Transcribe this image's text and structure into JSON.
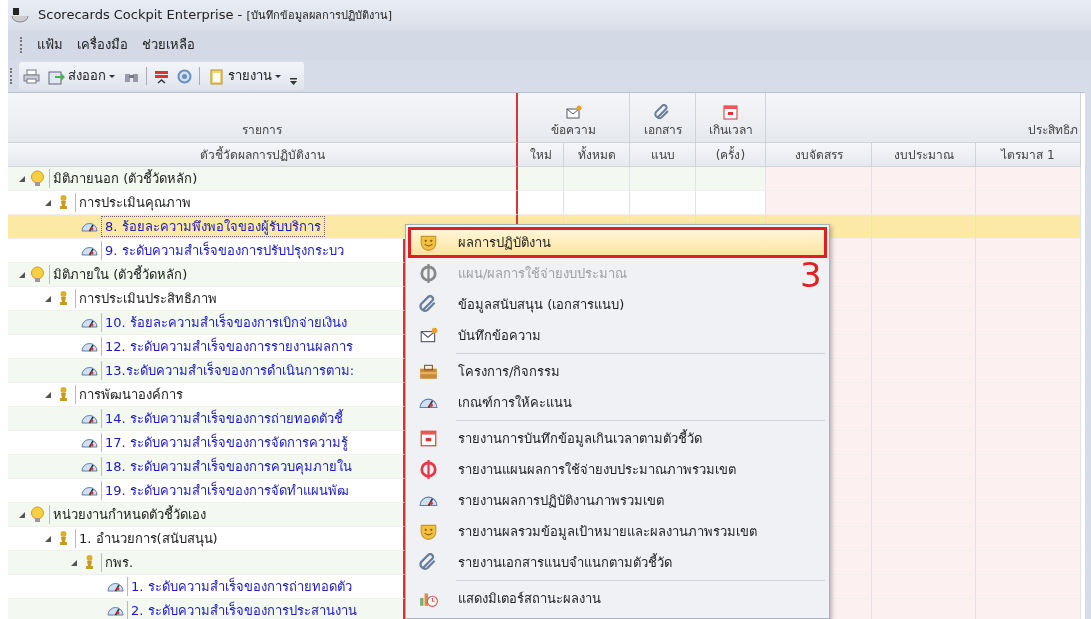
{
  "window": {
    "title": "Scorecards Cockpit Enterprise - ",
    "document": "[บันทึกข้อมูลผลการปฏิบัติงาน]"
  },
  "menu": [
    "แฟ้ม",
    "เครื่องมือ",
    "ช่วยเหลือ"
  ],
  "toolbar": [
    {
      "kind": "print"
    },
    {
      "kind": "export",
      "label": "ส่งออก",
      "dropdown": true
    },
    {
      "kind": "find"
    },
    {
      "kind": "separator"
    },
    {
      "kind": "flag"
    },
    {
      "kind": "refresh"
    },
    {
      "kind": "separator"
    },
    {
      "kind": "report",
      "label": "รายงาน",
      "dropdown": true
    },
    {
      "kind": "overflow"
    }
  ],
  "grid": {
    "top_headers": [
      "รายการ",
      "ข้อความ",
      "เอกสาร",
      "เกินเวลา",
      "ประสิทธิภ"
    ],
    "columns": [
      "ตัวชี้วัดผลการปฏิบัติงาน",
      "ใหม่",
      "ทั้งหมด",
      "แนบ",
      "(ครั้ง)",
      "งบจัดสรร",
      "งบประมาณ",
      "ไตรมาส 1"
    ],
    "tree": [
      {
        "kind": "dimension",
        "label": "มิติภายนอก (ตัวชี้วัดหลัก)",
        "expanded": true,
        "children": [
          {
            "kind": "group",
            "label": "การประเมินคุณภาพ",
            "expanded": true,
            "children": [
              {
                "kind": "indicator",
                "label": "8. ร้อยละความพึงพอใจของผู้รับบริการ",
                "selected": true
              },
              {
                "kind": "indicator",
                "label": "9. ระดับความสำเร็จของการปรับปรุงกระบว",
                "selected": false
              }
            ]
          }
        ]
      },
      {
        "kind": "dimension",
        "label": "มิติภายใน (ตัวชี้วัดหลัก)",
        "expanded": true,
        "children": [
          {
            "kind": "group",
            "label": "การประเมินประสิทธิภาพ",
            "expanded": true,
            "children": [
              {
                "kind": "indicator",
                "label": "10. ร้อยละความสำเร็จของการเบิกจ่ายเงินง",
                "selected": false
              },
              {
                "kind": "indicator",
                "label": "12. ระดับความสำเร็จของการรายงานผลการ",
                "selected": false
              },
              {
                "kind": "indicator",
                "label": "13.ระดับความสำเร็จของการดำเนินการตาม:",
                "selected": false
              }
            ]
          },
          {
            "kind": "group",
            "label": "การพัฒนาองค์การ",
            "expanded": true,
            "children": [
              {
                "kind": "indicator",
                "label": "14. ระดับความสำเร็จของการถ่ายทอดตัวชี้",
                "selected": false
              },
              {
                "kind": "indicator",
                "label": "17. ระดับความสำเร็จของการจัดการความรู้",
                "selected": false
              },
              {
                "kind": "indicator",
                "label": "18. ระดับความสำเร็จของการควบคุมภายใน",
                "selected": false
              },
              {
                "kind": "indicator",
                "label": "19. ระดับความสำเร็จของการจัดทำแผนพัฒ",
                "selected": false
              }
            ]
          }
        ]
      },
      {
        "kind": "dimension",
        "label": "หน่วยงานกำหนดตัวชี้วัดเอง",
        "expanded": true,
        "children": [
          {
            "kind": "group",
            "label": "1. อำนวยการ(สนับสนุน)",
            "expanded": true,
            "children": [
              {
                "kind": "group",
                "label": "กพร.",
                "expanded": true,
                "children": [
                  {
                    "kind": "indicator",
                    "label": "1. ระดับความสำเร็จของการถ่ายทอดตัว",
                    "selected": false
                  },
                  {
                    "kind": "indicator",
                    "label": "2. ระดับความสำเร็จของการประสานงาน",
                    "selected": false
                  }
                ]
              }
            ]
          }
        ]
      }
    ]
  },
  "context_menu": {
    "groups": [
      [
        {
          "kind": "performance",
          "label": "ผลการปฏิบัติงาน",
          "selected": true,
          "disabled": false
        },
        {
          "kind": "budget",
          "label": "แผน/ผลการใช้จ่ายงบประมาณ",
          "selected": false,
          "disabled": true
        },
        {
          "kind": "attachment",
          "label": "ข้อมูลสนับสนุน (เอกสารแนบ)",
          "selected": false,
          "disabled": false
        },
        {
          "kind": "memo",
          "label": "บันทึกข้อความ",
          "selected": false,
          "disabled": false
        }
      ],
      [
        {
          "kind": "project",
          "label": "โครงการ/กิจกรรม",
          "selected": false,
          "disabled": false
        },
        {
          "kind": "criteria",
          "label": "เกณฑ์การให้คะแนน",
          "selected": false,
          "disabled": false
        }
      ],
      [
        {
          "kind": "overdue",
          "label": "รายงานการบันทึกข้อมูลเกินเวลาตามตัวชี้วัด",
          "selected": false,
          "disabled": false
        },
        {
          "kind": "budget",
          "label": "รายงานแผนผลการใช้จ่ายงบประมาณภาพรวมเขต",
          "selected": false,
          "disabled": false
        },
        {
          "kind": "criteria",
          "label": "รายงานผลการปฏิบัติงานภาพรวมเขต",
          "selected": false,
          "disabled": false
        },
        {
          "kind": "performance",
          "label": "รายงานผลรวมข้อมูลเป้าหมายและผลงานภาพรวมเขต",
          "selected": false,
          "disabled": false
        },
        {
          "kind": "attachment",
          "label": "รายงานเอกสารแนบจำแนกตามตัวชี้วัด",
          "selected": false,
          "disabled": false
        }
      ],
      [
        {
          "kind": "meter",
          "label": "แสดงมิเตอร์สถานะผลงาน",
          "selected": false,
          "disabled": false
        }
      ]
    ]
  },
  "annotation": {
    "number": "3"
  }
}
